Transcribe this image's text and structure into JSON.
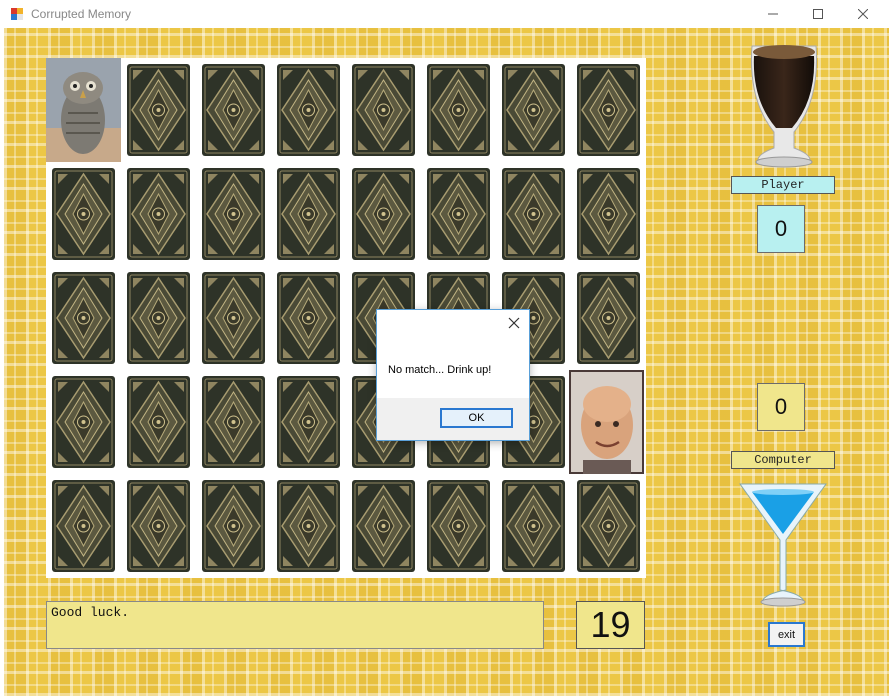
{
  "window": {
    "title": "Corrupted Memory",
    "controls": [
      "minimize",
      "maximize",
      "close"
    ]
  },
  "board": {
    "rows": 5,
    "cols": 8,
    "revealed": [
      {
        "row": 0,
        "col": 0,
        "image": "owl-robot-portrait"
      },
      {
        "row": 3,
        "col": 7,
        "image": "bald-man-portrait"
      }
    ],
    "card_back_pattern": "ornate-diamond"
  },
  "player": {
    "label": "Player",
    "score": "0",
    "drink_icon": "dark-beer-glass-icon",
    "accent_color": "#b8f0f0"
  },
  "computer": {
    "label": "Computer",
    "score": "0",
    "drink_icon": "blue-cocktail-glass-icon",
    "accent_color": "#f0e68c"
  },
  "status": {
    "message": "Good luck.",
    "counter": "19"
  },
  "exit_button": {
    "label": "exit"
  },
  "dialog": {
    "message": "No match... Drink up!",
    "ok_label": "OK"
  }
}
